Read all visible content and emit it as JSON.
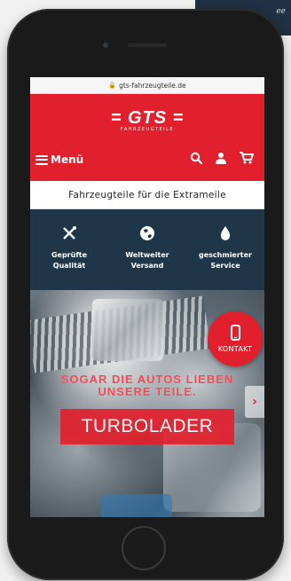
{
  "browser": {
    "url": "gts-fahrzeugteile.de",
    "lock_icon": "lock-icon"
  },
  "header": {
    "logo_main": "= GTS =",
    "logo_sub": "FAHRZEUGTEILE",
    "menu_label": "Menü",
    "icons": [
      "search-icon",
      "user-icon",
      "cart-icon"
    ],
    "background": "#e2202d"
  },
  "tagline": "Fahrzeugteile für die Extrameile",
  "features": [
    {
      "icon": "tools-icon",
      "line1": "Geprüfte",
      "line2": "Qualität"
    },
    {
      "icon": "globe-icon",
      "line1": "Weltweiter",
      "line2": "Versand"
    },
    {
      "icon": "oil-drop-icon",
      "line1": "geschmierter",
      "line2": "Service"
    }
  ],
  "hero": {
    "headline_line1": "SOGAR DIE AUTOS LIEBEN",
    "headline_line2": "UNSERE TEILE.",
    "banner": "TURBOLADER",
    "contact_label": "KONTAKT",
    "next_arrow": "›"
  },
  "colors": {
    "accent": "#e2202d",
    "navy": "#1f3548"
  }
}
